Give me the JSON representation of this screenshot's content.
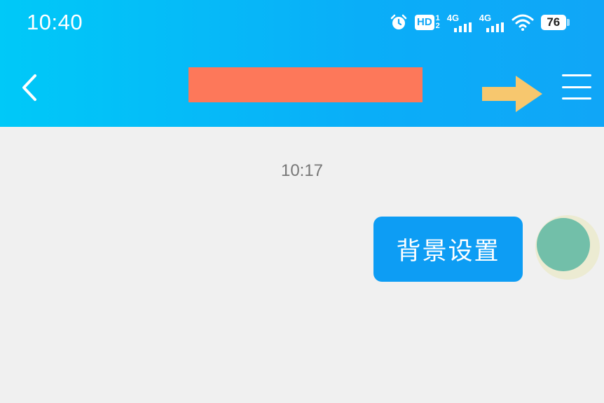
{
  "status_bar": {
    "time": "10:40",
    "icons": [
      "alarm-icon",
      "hd-icon",
      "signal-4g-icon",
      "signal-4g-icon",
      "wifi-icon",
      "battery-icon"
    ],
    "hd_label": "HD",
    "hd_sim1": "1",
    "hd_sim2": "2",
    "signal1_label": "4G",
    "signal2_label": "4G",
    "battery_level": "76"
  },
  "nav_bar": {
    "back_icon": "chevron-left-icon",
    "title": "",
    "menu_icon": "hamburger-menu-icon",
    "annotation_icon": "arrow-right-icon"
  },
  "chat": {
    "timestamp": "10:17",
    "messages": [
      {
        "sender": "self",
        "text": "背景设置",
        "avatar": "avatar"
      }
    ]
  },
  "colors": {
    "header_gradient_start": "#00c9f8",
    "header_gradient_end": "#10a6f7",
    "redaction": "#fd785a",
    "annotation_arrow": "#f7c76e",
    "bubble": "#0d9df4",
    "background": "#f0f0f0",
    "avatar": "#72bfa9"
  }
}
